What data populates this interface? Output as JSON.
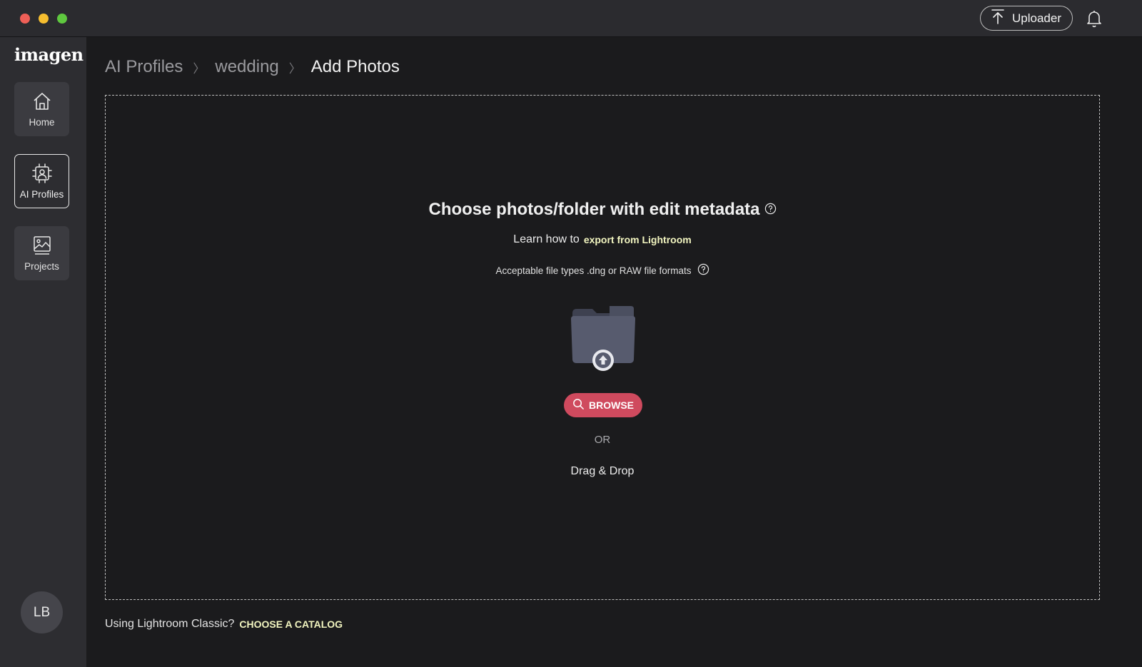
{
  "titlebar": {
    "uploader_label": "Uploader",
    "icons": {
      "uploader": "upload-arrow-icon",
      "notifications": "bell-icon"
    }
  },
  "sidebar": {
    "logo": "imagen",
    "items": [
      {
        "label": "Home",
        "icon": "home-icon",
        "active": false
      },
      {
        "label": "AI Profiles",
        "icon": "ai-profile-chip-icon",
        "active": true
      },
      {
        "label": "Projects",
        "icon": "image-gallery-icon",
        "active": false
      }
    ],
    "avatar_initials": "LB"
  },
  "breadcrumb": {
    "items": [
      "AI Profiles",
      "wedding"
    ],
    "current": "Add Photos",
    "separator": "〉"
  },
  "dropzone": {
    "heading": "Choose photos/folder with edit metadata",
    "learn_prefix": "Learn how to",
    "learn_link": "export from Lightroom",
    "file_types": "Acceptable file types .dng or RAW file formats",
    "browse_label": "BROWSE",
    "or_label": "OR",
    "drag_drop_label": "Drag & Drop"
  },
  "footer": {
    "prompt": "Using Lightroom Classic?",
    "link": "CHOOSE A CATALOG"
  },
  "colors": {
    "background": "#1b1b1d",
    "sidebar": "#2d2d31",
    "accent_button": "#cf4a5e",
    "link_highlight": "#f2f5c0"
  }
}
